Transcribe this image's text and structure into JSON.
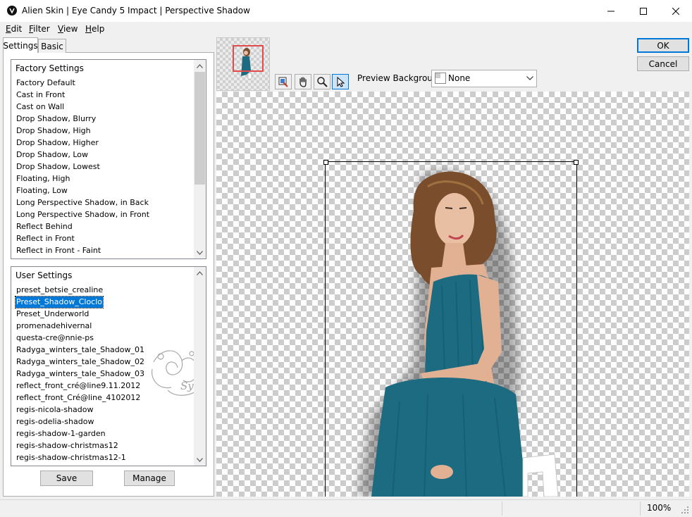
{
  "window": {
    "title": "Alien Skin | Eye Candy 5 Impact | Perspective Shadow",
    "icon": "alien-skin-icon",
    "controls": [
      "minimize-icon",
      "maximize-icon",
      "close-icon"
    ]
  },
  "menu": {
    "edit": {
      "u": "E",
      "rest": "dit"
    },
    "filter": {
      "u": "F",
      "rest": "ilter"
    },
    "view": {
      "u": "V",
      "rest": "iew"
    },
    "help": {
      "u": "H",
      "rest": "elp"
    }
  },
  "tabs": [
    "Settings",
    "Basic"
  ],
  "factory": {
    "header": "Factory Settings",
    "items": [
      "Factory Default",
      "Cast in Front",
      "Cast on Wall",
      "Drop Shadow, Blurry",
      "Drop Shadow, High",
      "Drop Shadow, Higher",
      "Drop Shadow, Low",
      "Drop Shadow, Lowest",
      "Floating, High",
      "Floating, Low",
      "Long Perspective Shadow, in Back",
      "Long Perspective Shadow, in Front",
      "Reflect Behind",
      "Reflect in Front",
      "Reflect in Front - Faint"
    ]
  },
  "user": {
    "header": "User Settings",
    "selected": "Preset_Shadow_Cloclo",
    "items": [
      "preset_betsie_crealine",
      "Preset_Shadow_Cloclo",
      "Preset_Underworld",
      "promenadehivernal",
      "questa-cre@nnie-ps",
      "Radyga_winters_tale_Shadow_01",
      "Radyga_winters_tale_Shadow_02",
      "Radyga_winters_tale_Shadow_03",
      "reflect_front_cré@line9.11.2012",
      "reflect_front_Cré@line_4102012",
      "regis-nicola-shadow",
      "regis-odelia-shadow",
      "regis-shadow-1-garden",
      "regis-shadow-christmas12",
      "regis-shadow-christmas12-1"
    ]
  },
  "buttons": {
    "save": "Save",
    "manage": "Manage",
    "ok": "OK",
    "cancel": "Cancel"
  },
  "tools": [
    "eye-dropper-icon",
    "hand-icon",
    "magnifier-icon",
    "arrow-pointer-icon"
  ],
  "preview_background": {
    "label": "Preview Background:",
    "value": "None"
  },
  "watermark_text": "Sylviane",
  "status": {
    "zoom": "100%"
  },
  "colors": {
    "selection": "#0078d7",
    "dress": "#1c6b80",
    "hair": "#7a4e2d",
    "skin": "#e9bfa4"
  }
}
